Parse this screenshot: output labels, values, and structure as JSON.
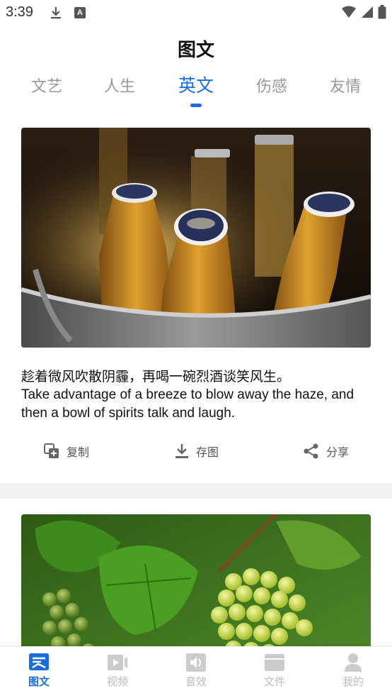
{
  "status_bar": {
    "time": "3:39",
    "a_badge": "A"
  },
  "page_title": "图文",
  "tabs": [
    {
      "label": "文艺",
      "active": false
    },
    {
      "label": "人生",
      "active": false
    },
    {
      "label": "英文",
      "active": true
    },
    {
      "label": "伤感",
      "active": false
    },
    {
      "label": "友情",
      "active": false
    }
  ],
  "cards": [
    {
      "image": "photo of beer bottles in an ice bucket",
      "text_zh": "趁着微风吹散阴霾，再喝一碗烈酒谈笑风生。",
      "text_en": "Take advantage of a breeze to blow away the haze, and then a bowl of spirits talk and laugh.",
      "actions": {
        "copy": "复制",
        "save": "存图",
        "share": "分享"
      }
    },
    {
      "image": "photo of green grapes on the vine"
    }
  ],
  "bottom_nav": [
    {
      "label": "图文",
      "icon": "image-text-icon",
      "active": true
    },
    {
      "label": "视频",
      "icon": "video-icon",
      "active": false
    },
    {
      "label": "音效",
      "icon": "sound-icon",
      "active": false
    },
    {
      "label": "文件",
      "icon": "folder-icon",
      "active": false
    },
    {
      "label": "我的",
      "icon": "profile-icon",
      "active": false
    }
  ],
  "colors": {
    "accent": "#1a6ddb",
    "inactive": "#999999"
  }
}
